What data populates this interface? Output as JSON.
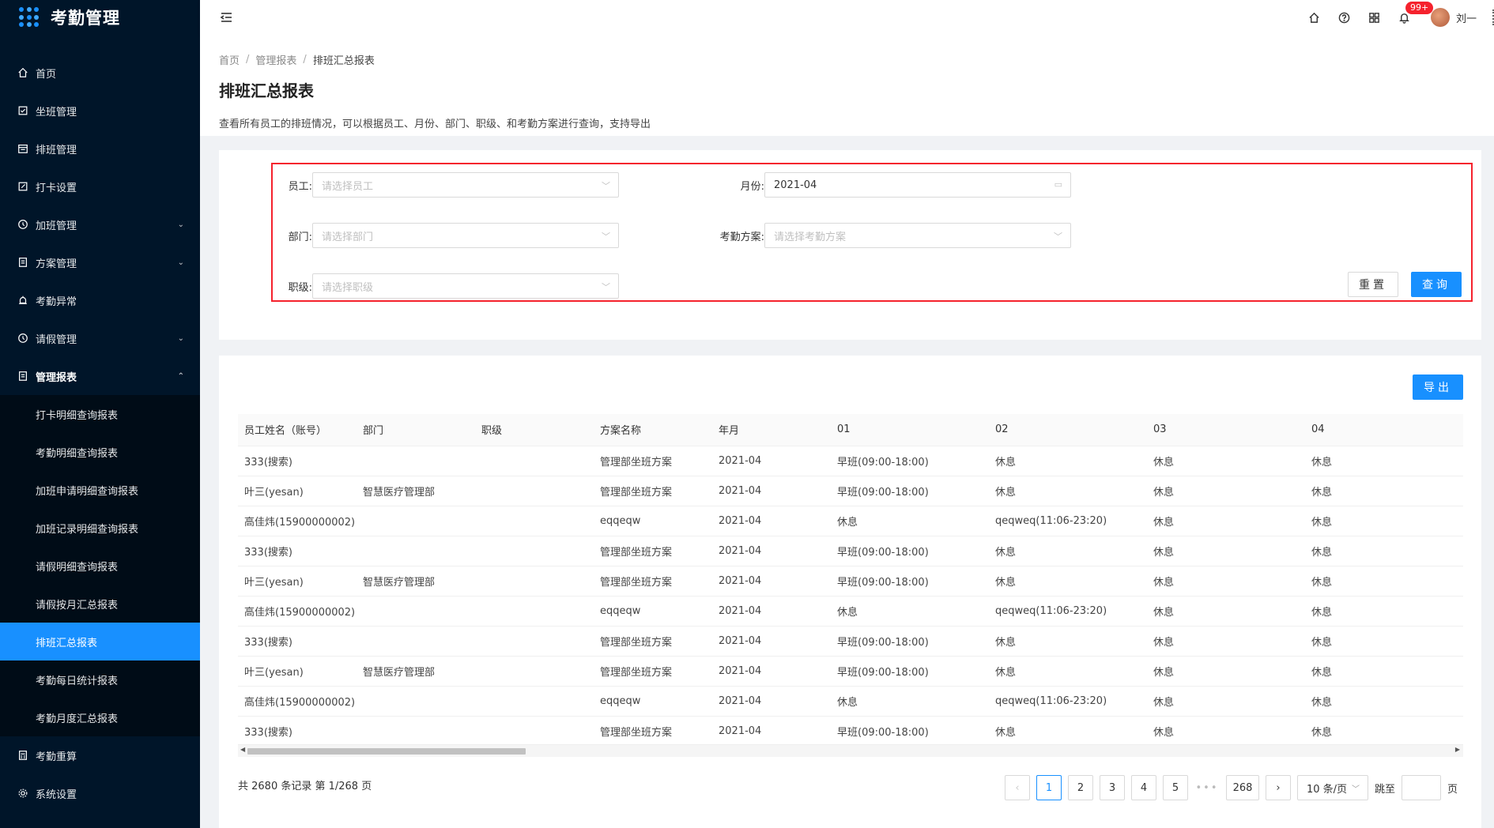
{
  "app": {
    "title": "考勤管理"
  },
  "sidebar": {
    "items": [
      {
        "label": "首页",
        "icon": "home-icon"
      },
      {
        "label": "坐班管理",
        "icon": "checkbox-icon"
      },
      {
        "label": "排班管理",
        "icon": "calendar-icon"
      },
      {
        "label": "打卡设置",
        "icon": "edit-icon"
      },
      {
        "label": "加班管理",
        "icon": "clock-icon",
        "arrow": "⌄"
      },
      {
        "label": "方案管理",
        "icon": "file-icon",
        "arrow": "⌄"
      },
      {
        "label": "考勤异常",
        "icon": "alarm-icon"
      },
      {
        "label": "请假管理",
        "icon": "clock-icon",
        "arrow": "⌄"
      },
      {
        "label": "管理报表",
        "icon": "file-icon",
        "arrow": "⌃"
      }
    ],
    "sub_items": [
      "打卡明细查询报表",
      "考勤明细查询报表",
      "加班申请明细查询报表",
      "加班记录明细查询报表",
      "请假明细查询报表",
      "请假按月汇总报表",
      "排班汇总报表",
      "考勤每日统计报表",
      "考勤月度汇总报表"
    ],
    "bottom_items": [
      {
        "label": "考勤重算",
        "icon": "calculator-icon"
      },
      {
        "label": "系统设置",
        "icon": "gear-icon"
      }
    ]
  },
  "header": {
    "notification_badge": "99+",
    "user_name": "刘一"
  },
  "breadcrumb": [
    "首页",
    "管理报表",
    "排班汇总报表"
  ],
  "page": {
    "title": "排班汇总报表",
    "description": "查看所有员工的排班情况，可以根据员工、月份、部门、职级、和考勤方案进行查询，支持导出"
  },
  "search": {
    "employee_label": "员工:",
    "employee_placeholder": "请选择员工",
    "month_label": "月份:",
    "month_value": "2021-04",
    "department_label": "部门:",
    "department_placeholder": "请选择部门",
    "plan_label": "考勤方案:",
    "plan_placeholder": "请选择考勤方案",
    "rank_label": "职级:",
    "rank_placeholder": "请选择职级",
    "reset_label": "重置",
    "query_label": "查询"
  },
  "table": {
    "export_label": "导出",
    "columns": [
      "员工姓名（账号）",
      "部门",
      "职级",
      "方案名称",
      "年月",
      "01",
      "02",
      "03",
      "04"
    ],
    "rows": [
      [
        "333(搜索)",
        "",
        "",
        "管理部坐班方案",
        "2021-04",
        "早班(09:00-18:00)",
        "休息",
        "休息",
        "休息"
      ],
      [
        "叶三(yesan)",
        "智慧医疗管理部",
        "",
        "管理部坐班方案",
        "2021-04",
        "早班(09:00-18:00)",
        "休息",
        "休息",
        "休息"
      ],
      [
        "高佳炜(15900000002)",
        "",
        "",
        "eqqeqw",
        "2021-04",
        "休息",
        "qeqweq(11:06-23:20)",
        "休息",
        "休息"
      ],
      [
        "333(搜索)",
        "",
        "",
        "管理部坐班方案",
        "2021-04",
        "早班(09:00-18:00)",
        "休息",
        "休息",
        "休息"
      ],
      [
        "叶三(yesan)",
        "智慧医疗管理部",
        "",
        "管理部坐班方案",
        "2021-04",
        "早班(09:00-18:00)",
        "休息",
        "休息",
        "休息"
      ],
      [
        "高佳炜(15900000002)",
        "",
        "",
        "eqqeqw",
        "2021-04",
        "休息",
        "qeqweq(11:06-23:20)",
        "休息",
        "休息"
      ],
      [
        "333(搜索)",
        "",
        "",
        "管理部坐班方案",
        "2021-04",
        "早班(09:00-18:00)",
        "休息",
        "休息",
        "休息"
      ],
      [
        "叶三(yesan)",
        "智慧医疗管理部",
        "",
        "管理部坐班方案",
        "2021-04",
        "早班(09:00-18:00)",
        "休息",
        "休息",
        "休息"
      ],
      [
        "高佳炜(15900000002)",
        "",
        "",
        "eqqeqw",
        "2021-04",
        "休息",
        "qeqweq(11:06-23:20)",
        "休息",
        "休息"
      ],
      [
        "333(搜索)",
        "",
        "",
        "管理部坐班方案",
        "2021-04",
        "早班(09:00-18:00)",
        "休息",
        "休息",
        "休息"
      ]
    ]
  },
  "pagination": {
    "total_text": "共 2680 条记录 第 1/268 页",
    "pages": [
      "1",
      "2",
      "3",
      "4",
      "5"
    ],
    "current": "1",
    "ellipsis": "•••",
    "last_page": "268",
    "page_size": "10 条/页",
    "jump_label": "跳至",
    "page_unit": "页"
  },
  "colors": {
    "sidebar_bg": "#001529",
    "primary": "#1890ff",
    "highlight_border": "#f5222d"
  }
}
